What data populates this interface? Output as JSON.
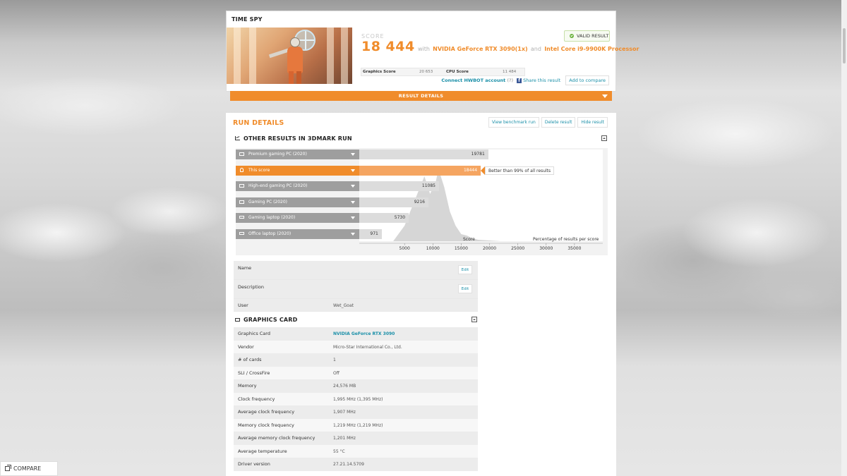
{
  "header": {
    "title": "TIME SPY",
    "score_label": "SCORE",
    "score_value": "18 444",
    "with_text": "with",
    "gpu_text": "NVIDIA GeForce RTX 3090(1x)",
    "and_text": "and",
    "cpu_text": "Intel Core i9-9900K Processor",
    "valid_label": "VALID RESULT",
    "graphics_score_label": "Graphics Score",
    "graphics_score_value": "20 653",
    "cpu_score_label": "CPU Score",
    "cpu_score_value": "11 484",
    "hwbot_label": "Connect HWBOT account",
    "hwbot_count": "(?)",
    "facebook_glyph": "f",
    "share_label": "Share this result",
    "compare_label": "Add to compare",
    "result_details_label": "RESULT DETAILS"
  },
  "run": {
    "title": "RUN DETAILS",
    "view_label": "View benchmark run",
    "delete_label": "Delete result",
    "hide_label": "Hide result",
    "section_title": "OTHER RESULTS IN 3DMARK RUN"
  },
  "chart_data": {
    "type": "bar",
    "categories": [
      "Premium gaming PC (2020)",
      "This score",
      "High-end gaming PC (2020)",
      "Gaming PC (2020)",
      "Gaming laptop (2020)",
      "Office laptop (2020)"
    ],
    "values": [
      19781,
      18444,
      11085,
      9216,
      5730,
      971
    ],
    "highlight_index": 1,
    "xlim": [
      -3000,
      40000
    ],
    "xticks": [
      5000,
      10000,
      15000,
      20000,
      25000,
      30000,
      35000
    ],
    "xlabel": "Score",
    "ylabel": "Percentage of results per score",
    "better_text": "Better than 99% of all results"
  },
  "details": {
    "name_label": "Name",
    "description_label": "Description",
    "user_label": "User",
    "user_value": "Wet_Goat",
    "edit_label": "Edit"
  },
  "graphics_card": {
    "title": "GRAPHICS CARD",
    "rows": [
      {
        "key": "Graphics Card",
        "value": "NVIDIA GeForce RTX 3090"
      },
      {
        "key": "Vendor",
        "value": "Micro-Star International Co., Ltd."
      },
      {
        "key": "# of cards",
        "value": "1"
      },
      {
        "key": "SLI / CrossFire",
        "value": "Off"
      },
      {
        "key": "Memory",
        "value": "24,576 MB"
      },
      {
        "key": "Clock frequency",
        "value": "1,995 MHz (1,395 MHz)"
      },
      {
        "key": "Average clock frequency",
        "value": "1,907 MHz"
      },
      {
        "key": "Memory clock frequency",
        "value": "1,219 MHz (1,219 MHz)"
      },
      {
        "key": "Average memory clock frequency",
        "value": "1,201 MHz"
      },
      {
        "key": "Average temperature",
        "value": "55 °C"
      },
      {
        "key": "Driver version",
        "value": "27.21.14.5709"
      }
    ]
  },
  "footer": {
    "compare_label": "COMPARE"
  }
}
